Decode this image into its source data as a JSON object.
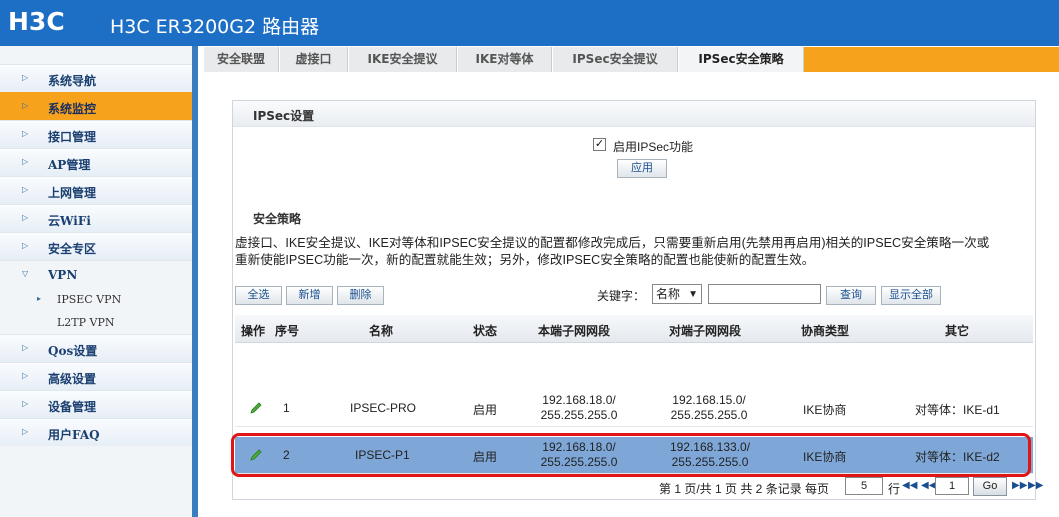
{
  "header": {
    "logo": "H3C",
    "title": "H3C ER3200G2 路由器"
  },
  "sidebar": {
    "items": [
      {
        "label": "系统导航"
      },
      {
        "label": "系统监控"
      },
      {
        "label": "接口管理"
      },
      {
        "label": "AP管理"
      },
      {
        "label": "上网管理"
      },
      {
        "label": "云WiFi"
      },
      {
        "label": "安全专区"
      },
      {
        "label": "VPN"
      },
      {
        "label": "Qos设置"
      },
      {
        "label": "高级设置"
      },
      {
        "label": "设备管理"
      },
      {
        "label": "用户FAQ"
      }
    ],
    "active": "系统监控",
    "vpn_sub": [
      "IPSEC VPN",
      "L2TP VPN"
    ]
  },
  "tabs": [
    "安全联盟",
    "虚接口",
    "IKE安全提议",
    "IKE对等体",
    "IPSec安全提议",
    "IPSec安全策略"
  ],
  "active_tab": "IPSec安全策略",
  "ipsec_settings": {
    "title": "IPSec设置",
    "enable_checked": true,
    "enable_label": "启用IPSec功能",
    "apply_button": "应用"
  },
  "policy": {
    "title": "安全策略",
    "description_line1": "虚接口、IKE安全提议、IKE对等体和IPSEC安全提议的配置都修改完成后，只需要重新启用(先禁用再启用)相关的IPSEC安全策略一次或",
    "description_line2": "重新使能IPSEC功能一次，新的配置就能生效；另外，修改IPSEC安全策略的配置也能使新的配置生效。",
    "buttons": {
      "select_all": "全选",
      "add": "新增",
      "delete": "删除",
      "search": "查询",
      "show_all": "显示全部"
    },
    "keyword_label": "关键字：",
    "keyword_field": "名称",
    "keyword_value": "",
    "columns": [
      "操作",
      "序号",
      "名称",
      "状态",
      "本端子网网段",
      "对端子网网段",
      "协商类型",
      "其它"
    ],
    "rows": [
      {
        "index": "1",
        "name": "IPSEC-PRO",
        "status": "启用",
        "local_a": "192.168.18.0/",
        "local_b": "255.255.255.0",
        "remote_a": "192.168.15.0/",
        "remote_b": "255.255.255.0",
        "type": "IKE协商",
        "other": "对等体：IKE-d1"
      },
      {
        "index": "2",
        "name": "IPSEC-P1",
        "status": "启用",
        "local_a": "192.168.18.0/",
        "local_b": "255.255.255.0",
        "remote_a": "192.168.133.0/",
        "remote_b": "255.255.255.0",
        "type": "IKE协商",
        "other": "对等体：IKE-d2"
      }
    ],
    "pager": {
      "summary": "第 1 页/共 1 页 共 2 条记录 每页",
      "per_page": "5",
      "rows_unit": "行",
      "page": "1",
      "go": "Go"
    }
  },
  "colors": {
    "header_blue": "#1c6fc5",
    "accent_orange": "#f7a21c",
    "selected_row": "#7ea7d8",
    "highlight_red": "#e01616"
  }
}
